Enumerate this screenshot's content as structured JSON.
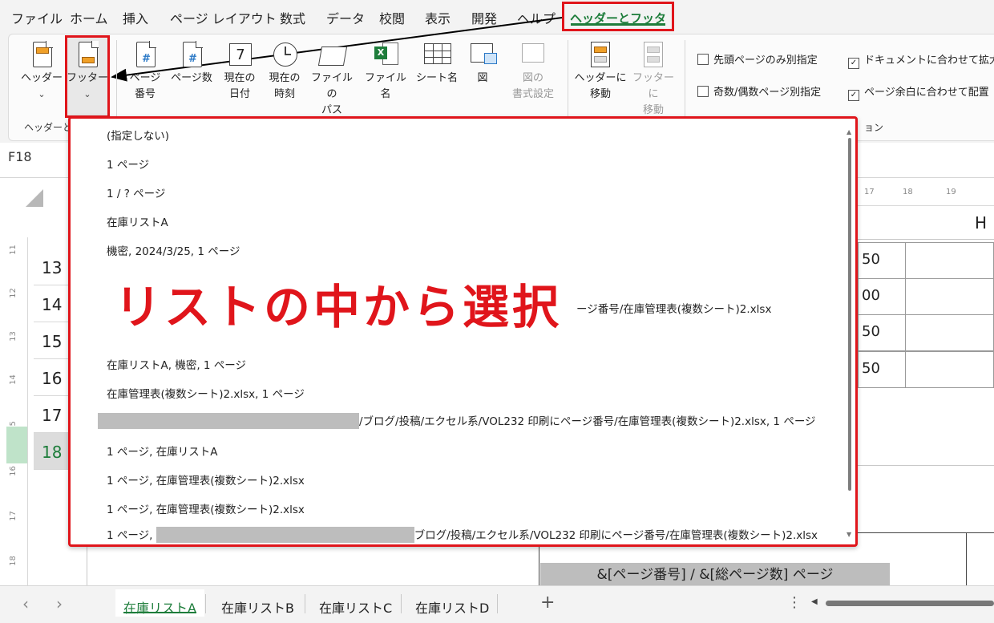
{
  "menu": {
    "file": "ファイル",
    "home": "ホーム",
    "insert": "挿入",
    "page_layout": "ページ レイアウト",
    "formulas": "数式",
    "data": "データ",
    "review": "校閲",
    "view": "表示",
    "developer": "開発",
    "help": "ヘルプ",
    "header_footer": "ヘッダーとフッター"
  },
  "ribbon": {
    "header_btn": "ヘッダー",
    "footer_btn": "フッター",
    "page_number_1": "ページ",
    "page_number_2": "番号",
    "page_count": "ページ数",
    "current_date_1": "現在の",
    "current_date_2": "日付",
    "current_time_1": "現在の",
    "current_time_2": "時刻",
    "file_path_1": "ファイルの",
    "file_path_2": "パス",
    "file_name": "ファイル名",
    "sheet_name": "シート名",
    "picture": "図",
    "format_picture_1": "図の",
    "format_picture_2": "書式設定",
    "goto_header_1": "ヘッダーに",
    "goto_header_2": "移動",
    "goto_footer_1": "フッターに",
    "goto_footer_2": "移動",
    "group_hf_label": "ヘッダーと",
    "group_options_label": "ョン",
    "opt_first_page": "先頭ページのみ別指定",
    "opt_odd_even": "奇数/偶数ページ別指定",
    "opt_scale_doc": "ドキュメントに合わせて拡大",
    "opt_align_margins": "ページ余白に合わせて配置"
  },
  "formula": {
    "name_box": "F18"
  },
  "sheet": {
    "rows": [
      "13",
      "14",
      "15",
      "16",
      "17",
      "18"
    ],
    "ruler_cols": [
      "17",
      "18",
      "19"
    ],
    "col_header_h": "H",
    "cell_values": [
      "50",
      "00",
      "50",
      "50"
    ],
    "ruler_rows": [
      "11",
      "12",
      "13",
      "14",
      "15",
      "16",
      "17",
      "18"
    ],
    "footer_preview": "&[ページ番号] / &[総ページ数] ページ"
  },
  "dropdown": {
    "options": [
      "(指定しない)",
      "1 ページ",
      "1 / ? ページ",
      "在庫リストA",
      " 機密, 2024/3/25, 1 ページ",
      "ージ番号/在庫管理表(複数シート)2.xlsx",
      "在庫リストA,  機密, 1 ページ",
      "在庫管理表(複数シート)2.xlsx, 1 ページ",
      "/ブログ/投稿/エクセル系/VOL232 印刷にページ番号/在庫管理表(複数シート)2.xlsx, 1 ページ",
      "1 ページ, 在庫リストA",
      "1 ページ, 在庫管理表(複数シート)2.xlsx",
      "1 ページ, 在庫管理表(複数シート)2.xlsx",
      "1 ページ, ",
      "ブログ/投稿/エクセル系/VOL232 印刷にページ番号/在庫管理表(複数シート)2.xlsx"
    ]
  },
  "annotation": {
    "overlay": "リストの中から選択"
  },
  "tabs": [
    "在庫リストA",
    "在庫リストB",
    "在庫リストC",
    "在庫リストD"
  ],
  "tabs_add": "+",
  "nav": {
    "prev": "‹",
    "next": "›",
    "more": "⋮"
  },
  "colors": {
    "accent_green": "#1e7d3b",
    "highlight_red": "#e0151b"
  }
}
